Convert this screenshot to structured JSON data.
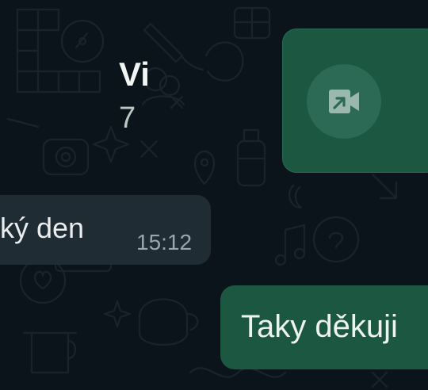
{
  "messages": {
    "call": {
      "title": "Vi",
      "subtitle": "7",
      "icon": "video-call-icon"
    },
    "incoming": {
      "text": "ký den",
      "time": "15:12"
    },
    "outgoing": {
      "text": "Taky děkuji"
    }
  },
  "colors": {
    "background": "#0b141a",
    "outgoing_bubble": "#1b5741",
    "incoming_bubble": "#202c33",
    "doodle_stroke": "#1c262c"
  }
}
